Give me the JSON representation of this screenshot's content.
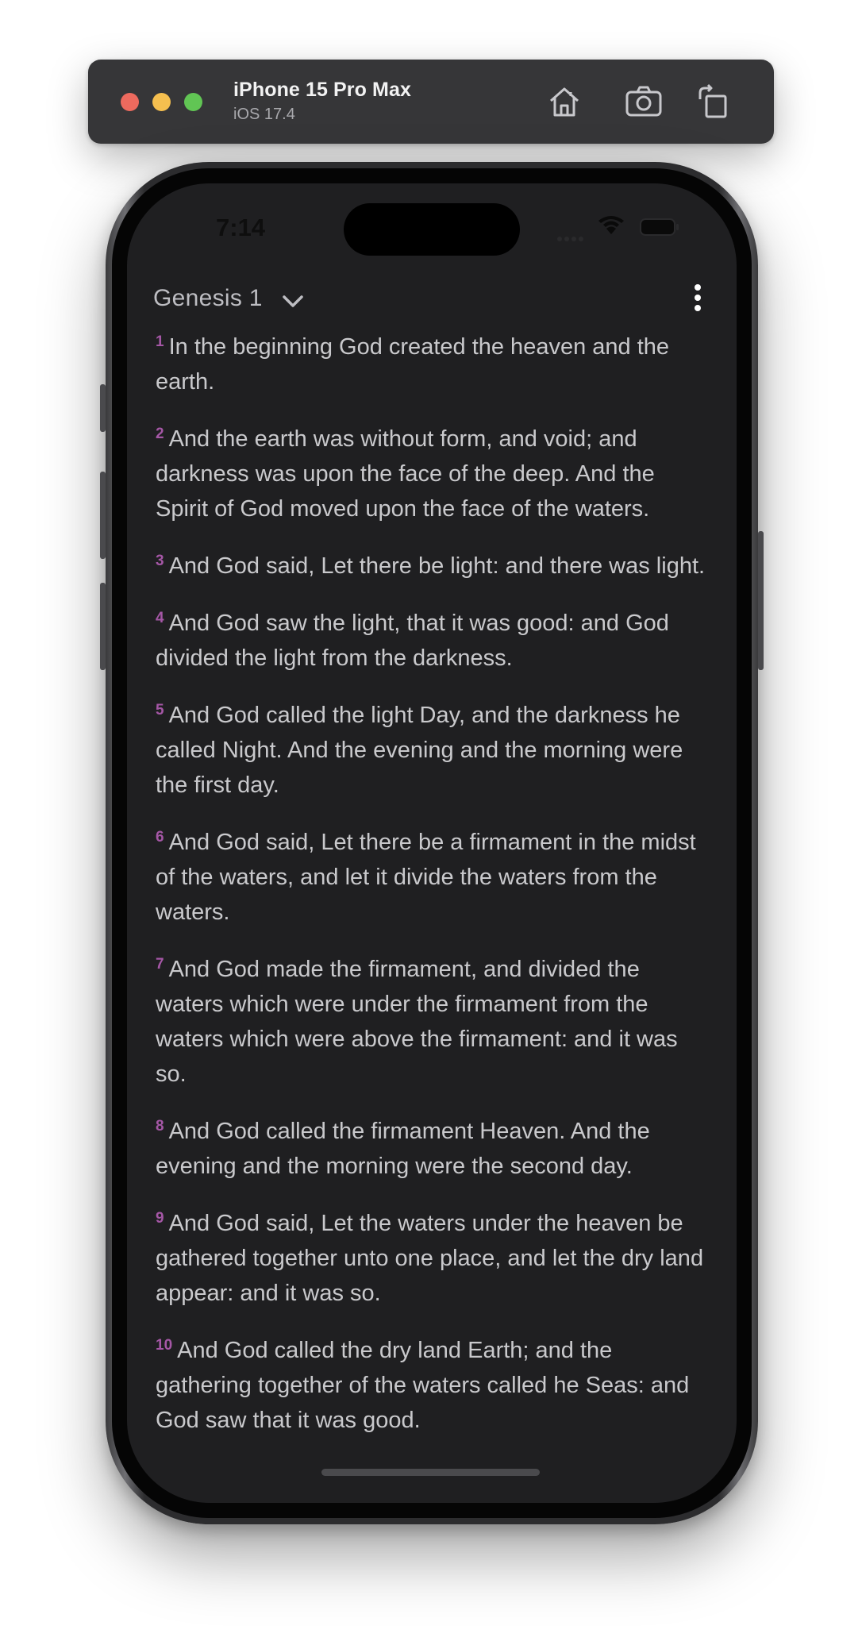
{
  "simulator": {
    "device_name": "iPhone 15 Pro Max",
    "os_version": "iOS 17.4",
    "toolbar_icons": [
      "home-icon",
      "screenshot-icon",
      "rotate-icon"
    ]
  },
  "status_bar": {
    "time": "7:14"
  },
  "header": {
    "chapter": "Genesis 1"
  },
  "colors": {
    "verse_number": "#a557a6",
    "background": "#1f1f21",
    "text": "#c9c9cc"
  },
  "verses": [
    {
      "num": "1",
      "text": "In the beginning God created the heaven and the earth."
    },
    {
      "num": "2",
      "text": "And the earth was without form, and void; and darkness was upon the face of the deep. And the Spirit of God moved upon the face of the waters."
    },
    {
      "num": "3",
      "text": "And God said, Let there be light: and there was light."
    },
    {
      "num": "4",
      "text": "And God saw the light, that it was good: and God divided the light from the darkness."
    },
    {
      "num": "5",
      "text": "And God called the light Day, and the darkness he called Night. And the evening and the morning were the first day."
    },
    {
      "num": "6",
      "text": "And God said, Let there be a firmament in the midst of the waters, and let it divide the waters from the waters."
    },
    {
      "num": "7",
      "text": "And God made the firmament, and divided the waters which were under the firmament from the waters which were above the firmament: and it was so."
    },
    {
      "num": "8",
      "text": "And God called the firmament Heaven. And the evening and the morning were the second day."
    },
    {
      "num": "9",
      "text": "And God said, Let the waters under the heaven be gathered together unto one place, and let the dry land appear: and it was so."
    },
    {
      "num": "10",
      "text": "And God called the dry land Earth; and the gathering together of the waters called he Seas: and God saw that it was good."
    }
  ]
}
